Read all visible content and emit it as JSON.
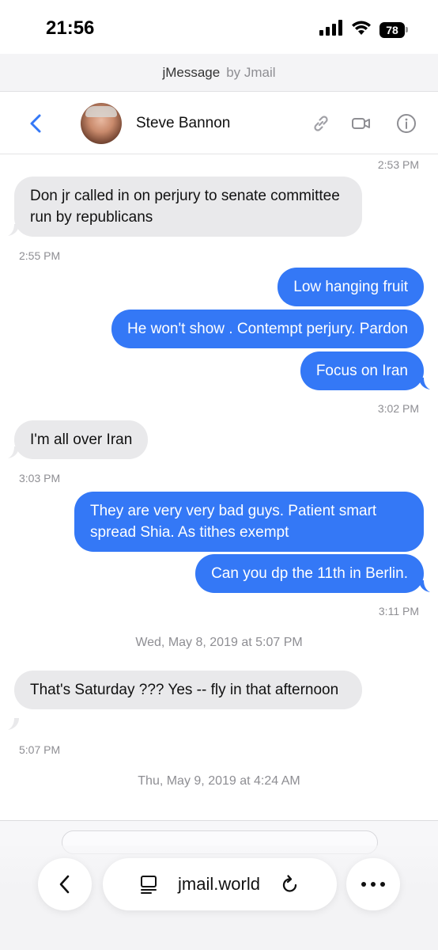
{
  "status_bar": {
    "time": "21:56",
    "battery": "78"
  },
  "url_header": {
    "app_name": "jMessage",
    "by_label": "by Jmail"
  },
  "chat_header": {
    "contact_name": "Steve Bannon"
  },
  "thread": {
    "timestamps": {
      "t1": "2:53 PM",
      "t2": "2:55 PM",
      "t3": "3:02 PM",
      "t4": "3:03 PM",
      "t5": "3:11 PM",
      "t6": "5:07 PM"
    },
    "date_separators": {
      "d1": "Wed, May 8, 2019 at 5:07 PM",
      "d2": "Thu, May 9, 2019 at 4:24 AM"
    },
    "messages": {
      "m1": "Don jr called in on perjury to senate committee run by republicans",
      "m2": "Low hanging fruit",
      "m3": "He won't show . Contempt perjury. Pardon",
      "m4": "Focus on Iran",
      "m5": "I'm all over Iran",
      "m6": "They are very very bad guys. Patient smart spread Shia. As tithes exempt",
      "m7": "Can you dp the 11th in Berlin.",
      "m8": "That's Saturday ??? Yes -- fly in that afternoon"
    }
  },
  "browser_bar": {
    "url": "jmail.world"
  },
  "colors": {
    "outgoing": "#3478f6",
    "incoming": "#e9e9eb",
    "accent": "#3478f6"
  },
  "icons": [
    "signal-icon",
    "wifi-icon",
    "battery-icon",
    "back-chevron-icon",
    "link-icon",
    "video-icon",
    "info-icon",
    "browser-back-icon",
    "tabs-icon",
    "reload-icon",
    "more-icon"
  ]
}
